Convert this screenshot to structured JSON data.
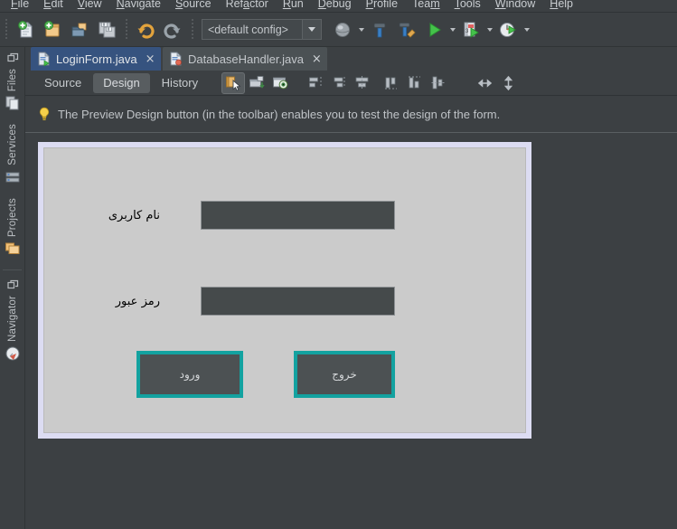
{
  "window": {
    "app": "NetBeans IDE",
    "bg_color": "#3c4043"
  },
  "menubar": {
    "items": [
      {
        "label": "File",
        "mnemonic": "F"
      },
      {
        "label": "Edit",
        "mnemonic": "E"
      },
      {
        "label": "View",
        "mnemonic": "V"
      },
      {
        "label": "Navigate",
        "mnemonic": "N"
      },
      {
        "label": "Source",
        "mnemonic": "S"
      },
      {
        "label": "Refactor",
        "mnemonic": "a"
      },
      {
        "label": "Run",
        "mnemonic": "R"
      },
      {
        "label": "Debug",
        "mnemonic": "D"
      },
      {
        "label": "Profile",
        "mnemonic": "P"
      },
      {
        "label": "Team",
        "mnemonic": "m"
      },
      {
        "label": "Tools",
        "mnemonic": "T"
      },
      {
        "label": "Window",
        "mnemonic": "W"
      },
      {
        "label": "Help",
        "mnemonic": "H"
      }
    ]
  },
  "toolbar": {
    "buttons": [
      {
        "name": "new-file-icon",
        "tooltip": "New File"
      },
      {
        "name": "new-project-icon",
        "tooltip": "New Project"
      },
      {
        "name": "open-project-icon",
        "tooltip": "Open Project"
      },
      {
        "name": "save-all-icon",
        "tooltip": "Save All"
      },
      {
        "name": "undo-icon",
        "tooltip": "Undo"
      },
      {
        "name": "redo-icon",
        "tooltip": "Redo"
      },
      {
        "name": "platform-icon",
        "tooltip": "Set Project Browser"
      },
      {
        "name": "build-project-icon",
        "tooltip": "Build Project"
      },
      {
        "name": "clean-and-build-icon",
        "tooltip": "Clean and Build Project"
      },
      {
        "name": "run-project-icon",
        "tooltip": "Run Project"
      },
      {
        "name": "debug-project-icon",
        "tooltip": "Debug Project"
      },
      {
        "name": "profile-project-icon",
        "tooltip": "Profile Project"
      }
    ],
    "config_combo": {
      "value": "<default config>",
      "name": "project-configuration-combo"
    }
  },
  "leftdock": {
    "groups": [
      {
        "tabs": [
          {
            "label": "Files",
            "icon": "files-icon"
          },
          {
            "label": "Services",
            "icon": "services-icon"
          },
          {
            "label": "Projects",
            "icon": "projects-icon"
          }
        ]
      },
      {
        "tabs": [
          {
            "label": "Navigator",
            "icon": "navigator-icon"
          }
        ]
      }
    ]
  },
  "editor_tabs": [
    {
      "label": "LoginForm.java",
      "active": true,
      "close": "×",
      "icon": "java-form-file-icon"
    },
    {
      "label": "DatabaseHandler.java",
      "active": false,
      "close": "×",
      "icon": "java-file-icon"
    }
  ],
  "design_toolbar": {
    "modes": [
      {
        "label": "Source",
        "selected": false
      },
      {
        "label": "Design",
        "selected": true
      },
      {
        "label": "History",
        "selected": false
      }
    ],
    "tools": [
      {
        "name": "selection-mode-icon",
        "pressed": true
      },
      {
        "name": "connection-mode-icon",
        "pressed": false
      },
      {
        "name": "preview-design-icon",
        "pressed": false
      },
      {
        "name": "align-left-icon",
        "pressed": false
      },
      {
        "name": "align-right-icon",
        "pressed": false
      },
      {
        "name": "align-center-horizontal-icon",
        "pressed": false
      },
      {
        "name": "align-top-icon",
        "pressed": false
      },
      {
        "name": "align-bottom-icon",
        "pressed": false
      },
      {
        "name": "align-center-vertical-icon",
        "pressed": false
      },
      {
        "name": "resize-horizontal-icon",
        "pressed": false
      },
      {
        "name": "resize-vertical-icon",
        "pressed": false
      }
    ]
  },
  "hint": {
    "icon": "lightbulb-icon",
    "text": "The Preview Design button (in the toolbar) enables you to test the design of the form."
  },
  "form": {
    "frame_border_color": "#dcdcf2",
    "surface_color": "#cbcbcb",
    "accent_color": "#13a2a0",
    "field_color": "#454a4b",
    "components": [
      {
        "type": "label",
        "name": "username-label",
        "text": "نام کاربری"
      },
      {
        "type": "label",
        "name": "password-label",
        "text": "رمز عبور"
      },
      {
        "type": "textfield",
        "name": "username-field",
        "value": ""
      },
      {
        "type": "textfield",
        "name": "password-field",
        "value": ""
      },
      {
        "type": "button",
        "name": "login-button",
        "text": "ورود"
      },
      {
        "type": "button",
        "name": "exit-button",
        "text": "خروج"
      }
    ]
  }
}
